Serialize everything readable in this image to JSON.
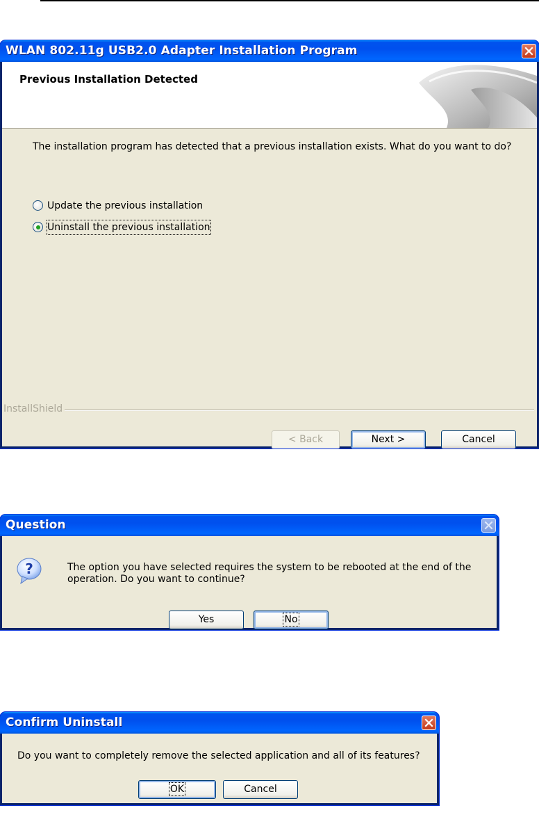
{
  "installer": {
    "title": "WLAN 802.11g USB2.0 Adapter Installation Program",
    "header_title": "Previous Installation Detected",
    "message": "The installation program has detected that a previous installation exists.  What do you want to do?",
    "options": [
      {
        "label": "Update the previous installation",
        "checked": false
      },
      {
        "label": "Uninstall the previous installation",
        "checked": true
      }
    ],
    "group_label": "InstallShield",
    "back_label": "< Back",
    "next_label": "Next >",
    "cancel_label": "Cancel"
  },
  "question": {
    "title": "Question",
    "message": "The option you have selected requires the system to be rebooted at the end of the operation. Do you want to continue?",
    "yes_label": "Yes",
    "no_label": "No"
  },
  "confirm": {
    "title": "Confirm Uninstall",
    "message": "Do you want to completely remove the selected application and all of its features?",
    "ok_label": "OK",
    "cancel_label": "Cancel"
  },
  "icons": {
    "close": "close-icon",
    "question": "question-icon"
  },
  "colors": {
    "titlebar": "#0055ea",
    "dialog_bg": "#ece9d8",
    "close_red": "#d2512f",
    "radio_dot": "#21a121"
  }
}
